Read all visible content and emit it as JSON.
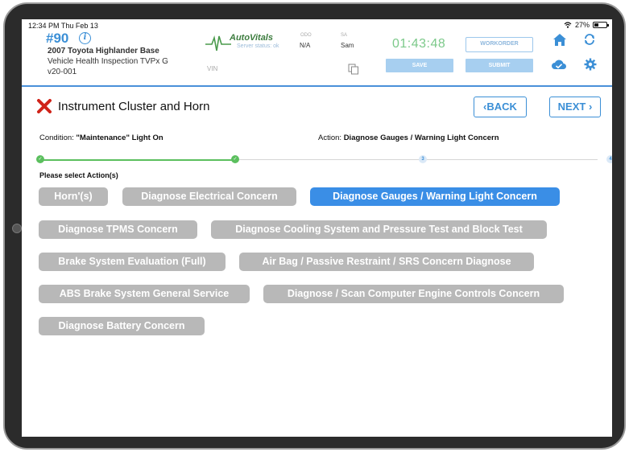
{
  "status_bar": {
    "time_date": "12:34 PM   Thu Feb 13",
    "battery": "27%"
  },
  "header": {
    "ro_number": "#90",
    "info_glyph": "i",
    "vehicle": "2007 Toyota Highlander Base",
    "inspection": "Vehicle Health Inspection TVPx G",
    "version": "v20-001",
    "logo_text": "AutoVitals",
    "logo_status": "Server status: ok",
    "vin_label": "VIN",
    "odo_label": "ODO",
    "odo_value": "N/A",
    "sa_label": "SA",
    "sa_value": "Sam",
    "timer": "01:43:48",
    "workorder_label": "WORKORDER",
    "save_label": "SAVE",
    "submit_label": "SUBMIT"
  },
  "section": {
    "title": "Instrument Cluster and Horn",
    "back_label": "BACK",
    "next_label": "NEXT",
    "condition_label": "Condition:",
    "condition_value": "\"Maintenance\" Light On",
    "action_label": "Action:",
    "action_value": "Diagnose Gauges / Warning Light Concern"
  },
  "progress": {
    "steps": [
      "✓",
      "✓",
      "3",
      "4"
    ],
    "completed": 2
  },
  "prompt": "Please select Action(s)",
  "actions": [
    {
      "label": "Horn'(s)",
      "selected": false
    },
    {
      "label": "Diagnose Electrical Concern",
      "selected": false
    },
    {
      "label": "Diagnose Gauges / Warning Light Concern",
      "selected": true
    },
    {
      "label": "Diagnose TPMS Concern",
      "selected": false
    },
    {
      "label": "Diagnose Cooling System and Pressure Test and Block Test",
      "selected": false
    },
    {
      "label": "Brake System Evaluation (Full)",
      "selected": false
    },
    {
      "label": "Air Bag / Passive Restraint / SRS Concern Diagnose",
      "selected": false
    },
    {
      "label": "ABS Brake System General Service",
      "selected": false
    },
    {
      "label": "Diagnose / Scan Computer Engine Controls Concern",
      "selected": false
    },
    {
      "label": "Diagnose Battery Concern",
      "selected": false
    }
  ],
  "colors": {
    "accent": "#3a8ee6",
    "chip": "#b8b8b8",
    "success": "#5bbf5e",
    "close": "#d0241a"
  }
}
